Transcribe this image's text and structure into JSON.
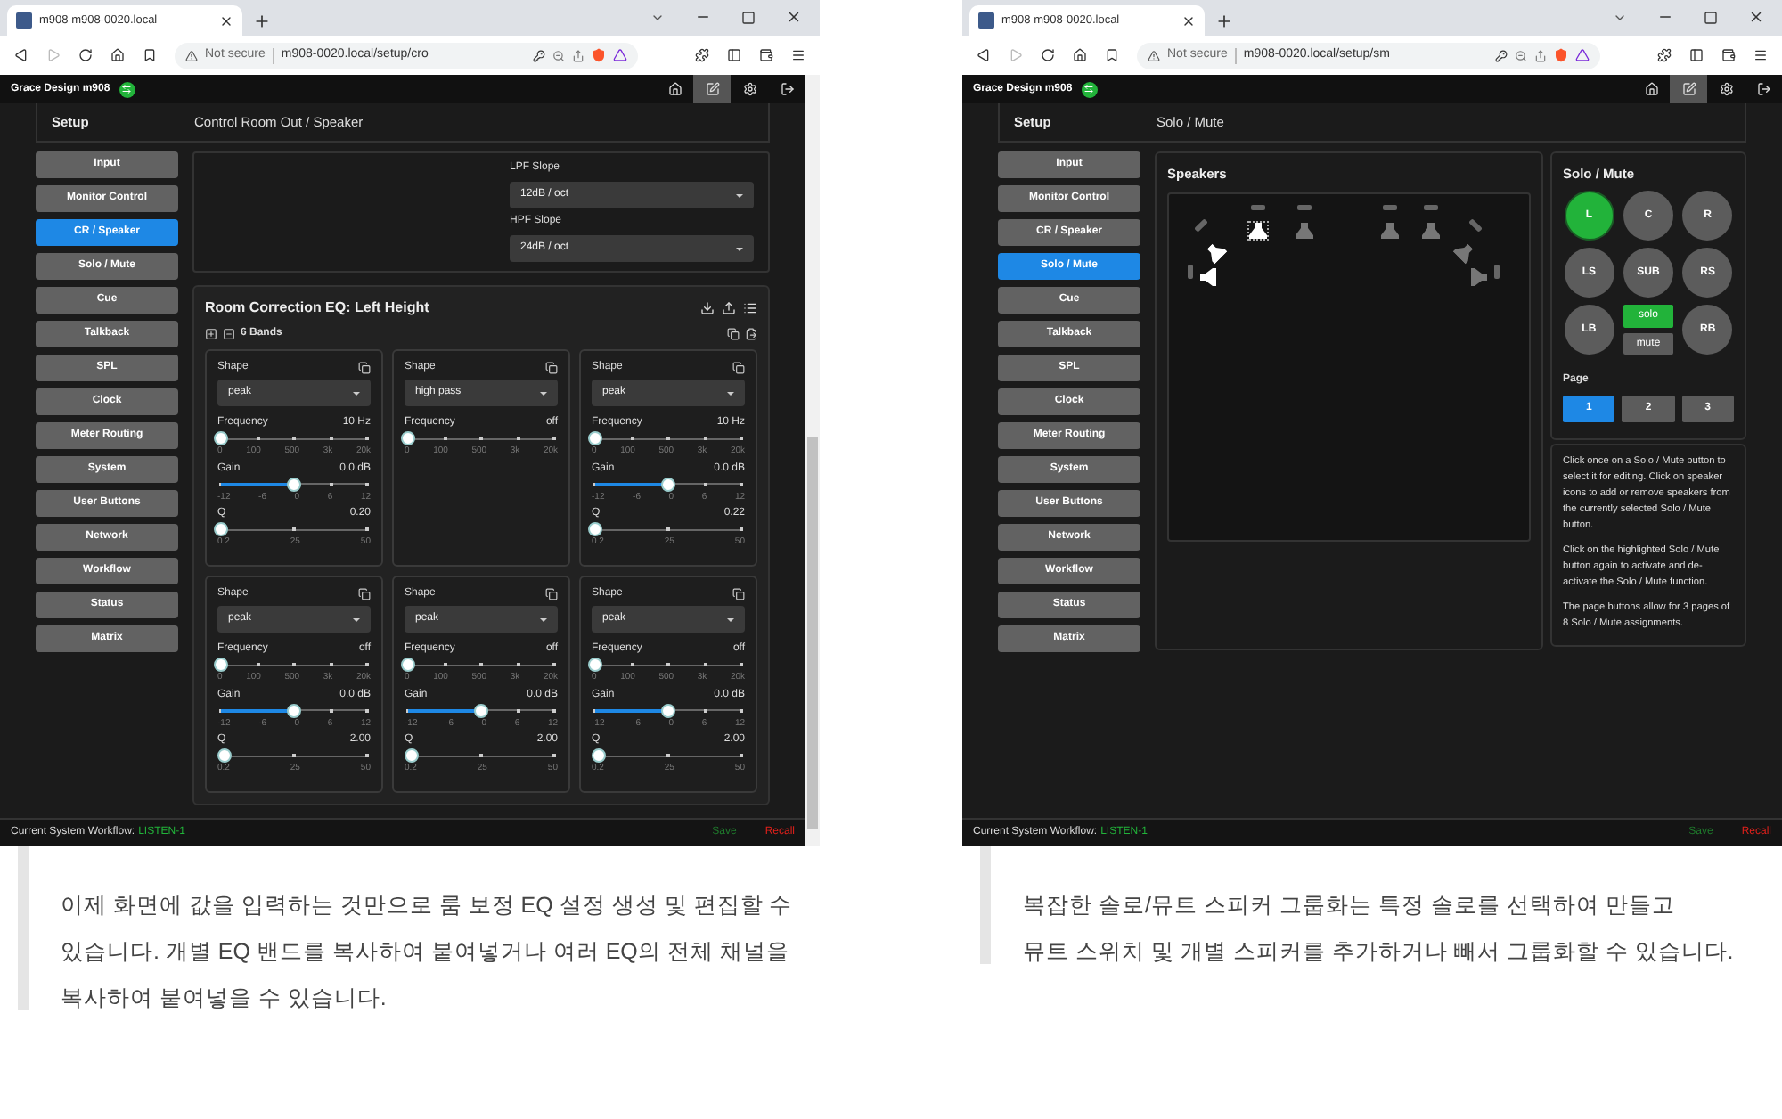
{
  "windows": [
    {
      "browser": {
        "tab_title": "m908 m908-0020.local",
        "security": "Not secure",
        "url": "m908-0020.local/setup/cro"
      },
      "app": {
        "brand": "Grace Design m908",
        "toolbar": [
          {
            "kind": "home",
            "selected": false
          },
          {
            "kind": "edit",
            "selected": true
          },
          {
            "kind": "settings",
            "selected": false
          },
          {
            "kind": "logout",
            "selected": false
          }
        ],
        "section": "Setup",
        "title": "Control Room Out / Speaker",
        "nav": [
          {
            "label": "Input",
            "selected": false
          },
          {
            "label": "Monitor Control",
            "selected": false
          },
          {
            "label": "CR / Speaker",
            "selected": true
          },
          {
            "label": "Solo / Mute",
            "selected": false
          },
          {
            "label": "Cue",
            "selected": false
          },
          {
            "label": "Talkback",
            "selected": false
          },
          {
            "label": "SPL",
            "selected": false
          },
          {
            "label": "Clock",
            "selected": false
          },
          {
            "label": "Meter Routing",
            "selected": false
          },
          {
            "label": "System",
            "selected": false
          },
          {
            "label": "User Buttons",
            "selected": false
          },
          {
            "label": "Network",
            "selected": false
          },
          {
            "label": "Workflow",
            "selected": false
          },
          {
            "label": "Status",
            "selected": false
          },
          {
            "label": "Matrix",
            "selected": false
          }
        ],
        "content": {
          "kind": "eq",
          "slopes": [
            {
              "label": "LPF Slope",
              "value": "12dB / oct"
            },
            {
              "label": "HPF Slope",
              "value": "24dB / oct"
            }
          ],
          "eq": {
            "title": "Room Correction EQ: Left Height",
            "bands_label": "6 Bands",
            "bands": [
              {
                "shape_label": "Shape",
                "shape": "peak",
                "params": [
                  {
                    "label": "Frequency",
                    "reading": "10 Hz",
                    "level": 0,
                    "ticks": [
                      "0",
                      "100",
                      "500",
                      "3k",
                      "20k"
                    ]
                  },
                  {
                    "label": "Gain",
                    "reading": "0.0 dB",
                    "level": 0.5,
                    "ticks": [
                      "-12",
                      "-6",
                      "0",
                      "6",
                      "12"
                    ]
                  },
                  {
                    "label": "Q",
                    "reading": "0.20",
                    "level": 0,
                    "ticks": [
                      "0.2",
                      "25",
                      "50"
                    ]
                  }
                ]
              },
              {
                "shape_label": "Shape",
                "shape": "high pass",
                "params": [
                  {
                    "label": "Frequency",
                    "reading": "off",
                    "level": 0,
                    "ticks": [
                      "0",
                      "100",
                      "500",
                      "3k",
                      "20k"
                    ]
                  }
                ]
              },
              {
                "shape_label": "Shape",
                "shape": "peak",
                "params": [
                  {
                    "label": "Frequency",
                    "reading": "10 Hz",
                    "level": 0,
                    "ticks": [
                      "0",
                      "100",
                      "500",
                      "3k",
                      "20k"
                    ]
                  },
                  {
                    "label": "Gain",
                    "reading": "0.0 dB",
                    "level": 0.5,
                    "ticks": [
                      "-12",
                      "-6",
                      "0",
                      "6",
                      "12"
                    ]
                  },
                  {
                    "label": "Q",
                    "reading": "0.22",
                    "level": 0,
                    "ticks": [
                      "0.2",
                      "25",
                      "50"
                    ]
                  }
                ]
              },
              {
                "shape_label": "Shape",
                "shape": "peak",
                "params": [
                  {
                    "label": "Frequency",
                    "reading": "off",
                    "level": 0,
                    "ticks": [
                      "0",
                      "100",
                      "500",
                      "3k",
                      "20k"
                    ]
                  },
                  {
                    "label": "Gain",
                    "reading": "0.0 dB",
                    "level": 0.5,
                    "ticks": [
                      "-12",
                      "-6",
                      "0",
                      "6",
                      "12"
                    ]
                  },
                  {
                    "label": "Q",
                    "reading": "2.00",
                    "level": 0.03,
                    "ticks": [
                      "0.2",
                      "25",
                      "50"
                    ]
                  }
                ]
              },
              {
                "shape_label": "Shape",
                "shape": "peak",
                "params": [
                  {
                    "label": "Frequency",
                    "reading": "off",
                    "level": 0,
                    "ticks": [
                      "0",
                      "100",
                      "500",
                      "3k",
                      "20k"
                    ]
                  },
                  {
                    "label": "Gain",
                    "reading": "0.0 dB",
                    "level": 0.5,
                    "ticks": [
                      "-12",
                      "-6",
                      "0",
                      "6",
                      "12"
                    ]
                  },
                  {
                    "label": "Q",
                    "reading": "2.00",
                    "level": 0.03,
                    "ticks": [
                      "0.2",
                      "25",
                      "50"
                    ]
                  }
                ]
              },
              {
                "shape_label": "Shape",
                "shape": "peak",
                "params": [
                  {
                    "label": "Frequency",
                    "reading": "off",
                    "level": 0,
                    "ticks": [
                      "0",
                      "100",
                      "500",
                      "3k",
                      "20k"
                    ]
                  },
                  {
                    "label": "Gain",
                    "reading": "0.0 dB",
                    "level": 0.5,
                    "ticks": [
                      "-12",
                      "-6",
                      "0",
                      "6",
                      "12"
                    ]
                  },
                  {
                    "label": "Q",
                    "reading": "2.00",
                    "level": 0.03,
                    "ticks": [
                      "0.2",
                      "25",
                      "50"
                    ]
                  }
                ]
              }
            ]
          }
        },
        "footer": {
          "label": "Current System Workflow:",
          "workflow": "LISTEN-1",
          "save": "Save",
          "recall": "Recall"
        }
      }
    },
    {
      "browser": {
        "tab_title": "m908 m908-0020.local",
        "security": "Not secure",
        "url": "m908-0020.local/setup/sm"
      },
      "app": {
        "brand": "Grace Design m908",
        "toolbar": [
          {
            "kind": "home",
            "selected": false
          },
          {
            "kind": "edit",
            "selected": true
          },
          {
            "kind": "settings",
            "selected": false
          },
          {
            "kind": "logout",
            "selected": false
          }
        ],
        "section": "Setup",
        "title": "Solo / Mute",
        "nav": [
          {
            "label": "Input",
            "selected": false
          },
          {
            "label": "Monitor Control",
            "selected": false
          },
          {
            "label": "CR / Speaker",
            "selected": false
          },
          {
            "label": "Solo / Mute",
            "selected": true
          },
          {
            "label": "Cue",
            "selected": false
          },
          {
            "label": "Talkback",
            "selected": false
          },
          {
            "label": "SPL",
            "selected": false
          },
          {
            "label": "Clock",
            "selected": false
          },
          {
            "label": "Meter Routing",
            "selected": false
          },
          {
            "label": "System",
            "selected": false
          },
          {
            "label": "User Buttons",
            "selected": false
          },
          {
            "label": "Network",
            "selected": false
          },
          {
            "label": "Workflow",
            "selected": false
          },
          {
            "label": "Status",
            "selected": false
          },
          {
            "label": "Matrix",
            "selected": false
          }
        ],
        "content": {
          "kind": "solo_mute",
          "speakers": {
            "title": "Speakers",
            "items": [
              {
                "selected": true
              },
              {
                "selected": true
              },
              {
                "selected": false
              },
              {
                "selected": false
              },
              {
                "selected": false
              },
              {
                "selected": false
              },
              {
                "selected": true
              },
              {
                "selected": false
              }
            ]
          },
          "solo_mute": {
            "title": "Solo / Mute",
            "buttons": [
              {
                "kind": "channel",
                "label": "L",
                "selected": true
              },
              {
                "kind": "channel",
                "label": "C",
                "selected": false
              },
              {
                "kind": "channel",
                "label": "R",
                "selected": false
              },
              {
                "kind": "channel",
                "label": "LS",
                "selected": false
              },
              {
                "kind": "channel",
                "label": "SUB",
                "selected": false
              },
              {
                "kind": "channel",
                "label": "RS",
                "selected": false
              },
              {
                "kind": "channel",
                "label": "LB",
                "selected": false
              },
              {
                "kind": "channel",
                "label": "RB",
                "selected": false
              }
            ],
            "toggles": [
              {
                "label": "solo",
                "on": true
              },
              {
                "label": "mute",
                "on": false
              }
            ],
            "page_label": "Page",
            "pages": [
              {
                "label": "1",
                "selected": true
              },
              {
                "label": "2",
                "selected": false
              },
              {
                "label": "3",
                "selected": false
              }
            ]
          },
          "help": [
            "Click once on a Solo / Mute button to select it for editing. Click on speaker icons to add or remove speakers from the currently selected Solo / Mute button.",
            "Click on the highlighted Solo / Mute button again to activate and de-activate the Solo / Mute function.",
            "The page buttons allow for 3 pages of 8 Solo / Mute assignments."
          ]
        },
        "footer": {
          "label": "Current System Workflow:",
          "workflow": "LISTEN-1",
          "save": "Save",
          "recall": "Recall"
        }
      }
    }
  ],
  "captions": [
    {
      "lines": [
        "이제 화면에 값을 입력하는 것만으로 룸 보정 EQ 설정 생성 및 편집할 수",
        "있습니다. 개별 EQ 밴드를 복사하여 붙여넣거나 여러 EQ의 전체 채널을",
        "복사하여 붙여넣을 수 있습니다."
      ]
    },
    {
      "lines": [
        "복잡한 솔로/뮤트 스피커 그룹화는 특정 솔로를 선택하여 만들고",
        "뮤트 스위치 및 개별 스피커를 추가하거나 빼서 그룹화할 수 있습니다."
      ]
    }
  ]
}
